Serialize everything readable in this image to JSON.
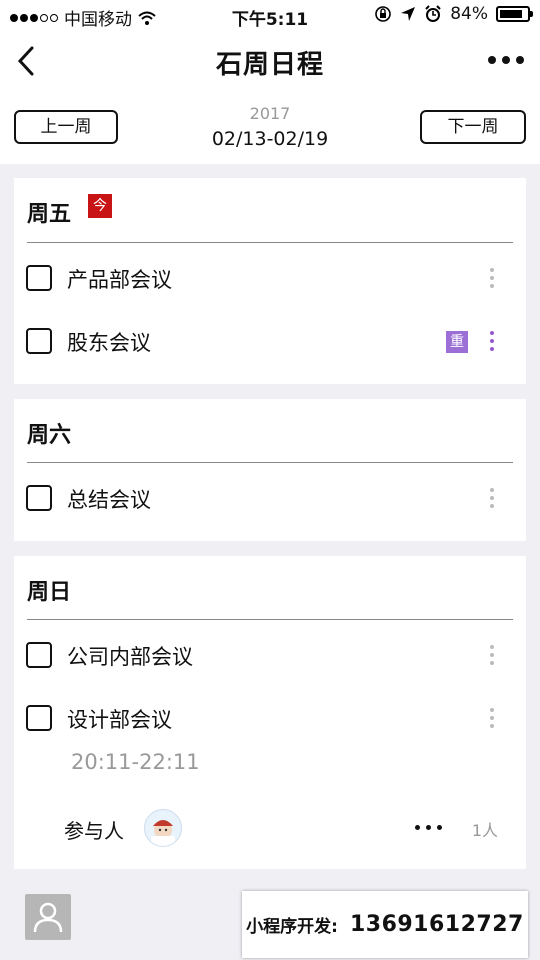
{
  "status_bar": {
    "carrier": "中国移动",
    "time": "下午5:11",
    "battery": "84%",
    "battery_level": 0.84
  },
  "nav": {
    "title": "石周日程"
  },
  "week": {
    "prev_label": "上一周",
    "next_label": "下一周",
    "year": "2017",
    "range": "02/13-02/19"
  },
  "days": [
    {
      "title": "周五",
      "today_badge": "今",
      "tasks": [
        {
          "label": "产品部会议"
        },
        {
          "label": "股东会议",
          "badge": "重"
        }
      ]
    },
    {
      "title": "周六",
      "tasks": [
        {
          "label": "总结会议"
        }
      ]
    },
    {
      "title": "周日",
      "tasks": [
        {
          "label": "公司内部会议"
        },
        {
          "label": "设计部会议",
          "time": "20:11-22:11",
          "participants_label": "参与人",
          "participant_count": "1人"
        }
      ]
    }
  ],
  "footer": {
    "promo_label": "小程序开发:",
    "promo_phone": "13691612727"
  },
  "colors": {
    "today_badge": "#c81414",
    "important_badge": "#9b6fd6",
    "background": "#efeff4"
  }
}
